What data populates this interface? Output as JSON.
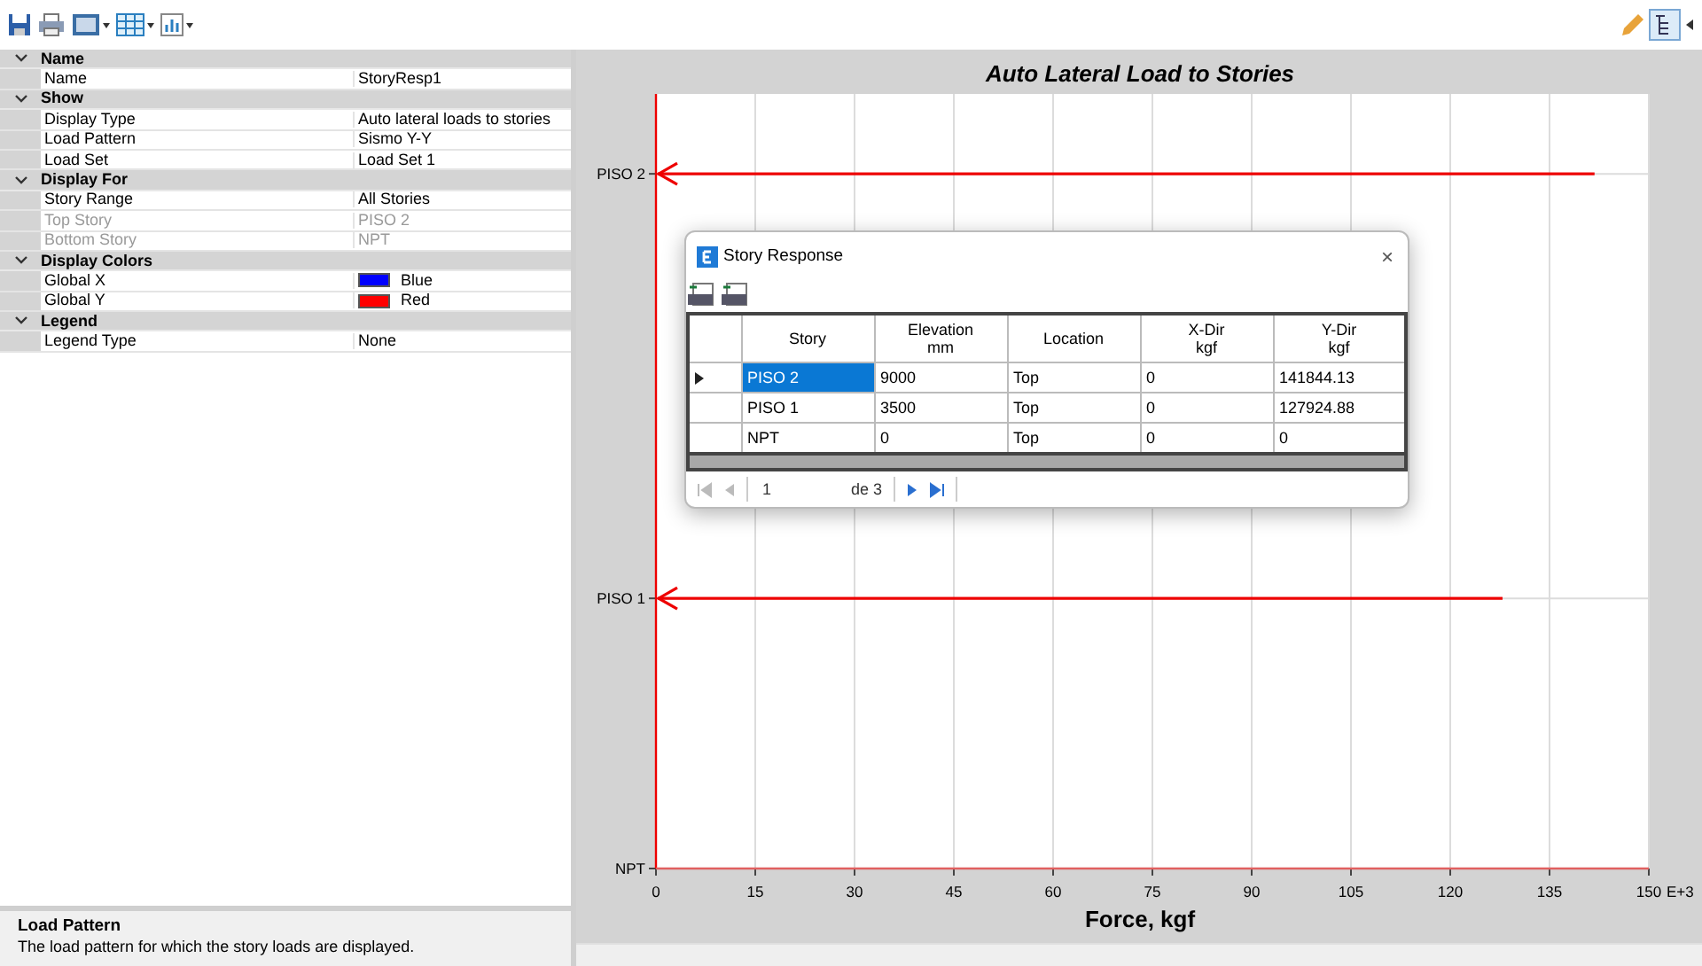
{
  "properties": [
    {
      "category": "Name",
      "expanded": true,
      "items": [
        {
          "kind": "text",
          "name": "Name",
          "value": "StoryResp1",
          "disabled": false
        }
      ]
    },
    {
      "category": "Show",
      "expanded": true,
      "items": [
        {
          "kind": "text",
          "name": "Display Type",
          "value": "Auto lateral loads to stories",
          "disabled": false
        },
        {
          "kind": "text",
          "name": "Load Pattern",
          "value": "Sismo Y-Y",
          "disabled": false
        },
        {
          "kind": "text",
          "name": "Load Set",
          "value": "Load Set 1",
          "disabled": false
        }
      ]
    },
    {
      "category": "Display For",
      "expanded": true,
      "items": [
        {
          "kind": "text",
          "name": "Story Range",
          "value": "All Stories",
          "disabled": false
        },
        {
          "kind": "text",
          "name": "Top Story",
          "value": "PISO 2",
          "disabled": true
        },
        {
          "kind": "text",
          "name": "Bottom Story",
          "value": "NPT",
          "disabled": true
        }
      ]
    },
    {
      "category": "Display Colors",
      "expanded": true,
      "items": [
        {
          "kind": "color",
          "name": "Global X",
          "value": "Blue",
          "color": "#0000ff",
          "disabled": false
        },
        {
          "kind": "color",
          "name": "Global Y",
          "value": "Red",
          "color": "#ff0000",
          "disabled": false
        }
      ]
    },
    {
      "category": "Legend",
      "expanded": true,
      "items": [
        {
          "kind": "text",
          "name": "Legend Type",
          "value": "None",
          "disabled": false
        }
      ]
    }
  ],
  "description": {
    "title": "Load Pattern",
    "text": "The load pattern for which the story loads are displayed."
  },
  "chart": {
    "title": "Auto Lateral Load to Stories",
    "scale_label": "E+3",
    "chart_data": {
      "type": "bar",
      "orientation": "horizontal",
      "xlabel": "Force, kgf",
      "categories": [
        "PISO 2",
        "PISO 1",
        "NPT"
      ],
      "values": [
        141.8,
        127.9,
        0
      ],
      "xlim": [
        0,
        150
      ],
      "xticks": [
        0,
        15,
        30,
        45,
        60,
        75,
        90,
        105,
        120,
        135,
        150
      ],
      "grid": true
    }
  },
  "dialog": {
    "title": "Story Response",
    "close": "×",
    "columns": [
      {
        "label": "Story"
      },
      {
        "label": "Elevation",
        "unit": "mm"
      },
      {
        "label": "Location"
      },
      {
        "label": "X-Dir",
        "unit": "kgf"
      },
      {
        "label": "Y-Dir",
        "unit": "kgf"
      }
    ],
    "rows": [
      {
        "selected": true,
        "cells": [
          "PISO 2",
          "9000",
          "Top",
          "0",
          "141844.13"
        ]
      },
      {
        "selected": false,
        "cells": [
          "PISO 1",
          "3500",
          "Top",
          "0",
          "127924.88"
        ]
      },
      {
        "selected": false,
        "cells": [
          "NPT",
          "0",
          "Top",
          "0",
          "0"
        ]
      }
    ],
    "navigator": {
      "page": "1",
      "of": "de 3"
    }
  }
}
